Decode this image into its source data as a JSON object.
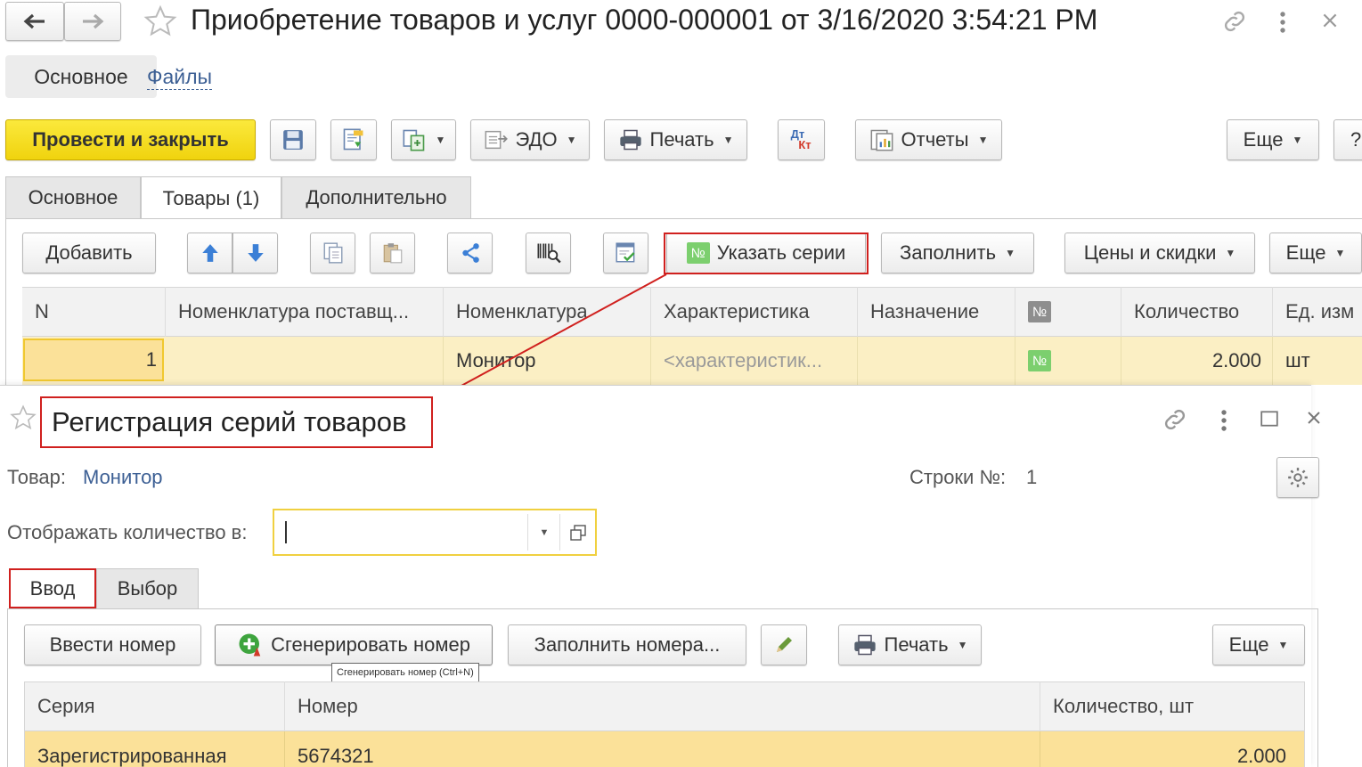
{
  "top_window": {
    "title": "Приобретение товаров и услуг 0000-000001 от 3/16/2020 3:54:21 PM",
    "nav_tabs": [
      "Основное",
      "Файлы"
    ],
    "toolbar": {
      "post_close": "Провести и закрыть",
      "edo": "ЭДО",
      "print": "Печать",
      "dtkt": "Дт Кт",
      "reports": "Отчеты",
      "more": "Еще",
      "help": "?"
    },
    "doc_tabs": [
      "Основное",
      "Товары (1)",
      "Дополнительно"
    ],
    "goods_toolbar": {
      "add": "Добавить",
      "series": "Указать серии",
      "fill": "Заполнить",
      "prices": "Цены и скидки",
      "more": "Еще"
    },
    "table": {
      "columns": [
        "N",
        "Номенклатура поставщ...",
        "Номенклатура",
        "Характеристика",
        "Назначение",
        "№",
        "Количество",
        "Ед. изм"
      ],
      "row": {
        "n": "1",
        "supplier_item": "",
        "item": "Монитор",
        "characteristic": "<характеристик...",
        "purpose": "",
        "series_badge": "№",
        "quantity": "2.000",
        "unit": "шт"
      }
    }
  },
  "series_window": {
    "title": "Регистрация серий товаров",
    "product_label": "Товар:",
    "product_value": "Монитор",
    "rows_label": "Строки №:",
    "rows_value": "1",
    "display_qty_label": "Отображать количество в:",
    "display_qty_value": "",
    "tabs": [
      "Ввод",
      "Выбор"
    ],
    "toolbar": {
      "enter_number": "Ввести номер",
      "generate_number": "Сгенерировать номер",
      "fill_numbers": "Заполнить номера...",
      "print": "Печать",
      "more": "Еще"
    },
    "tooltip": "Сгенерировать номер (Ctrl+N)",
    "table": {
      "columns": [
        "Серия",
        "Номер",
        "Количество, шт"
      ],
      "row": {
        "series": "Зарегистрированная",
        "number": "5674321",
        "quantity": "2.000"
      }
    }
  },
  "colors": {
    "accent_yellow": "#f4de1c",
    "row_highlight": "#fbefc4",
    "selected_row": "#fbe199",
    "link_blue": "#3c5f94",
    "annotation_red": "#d0201e"
  }
}
